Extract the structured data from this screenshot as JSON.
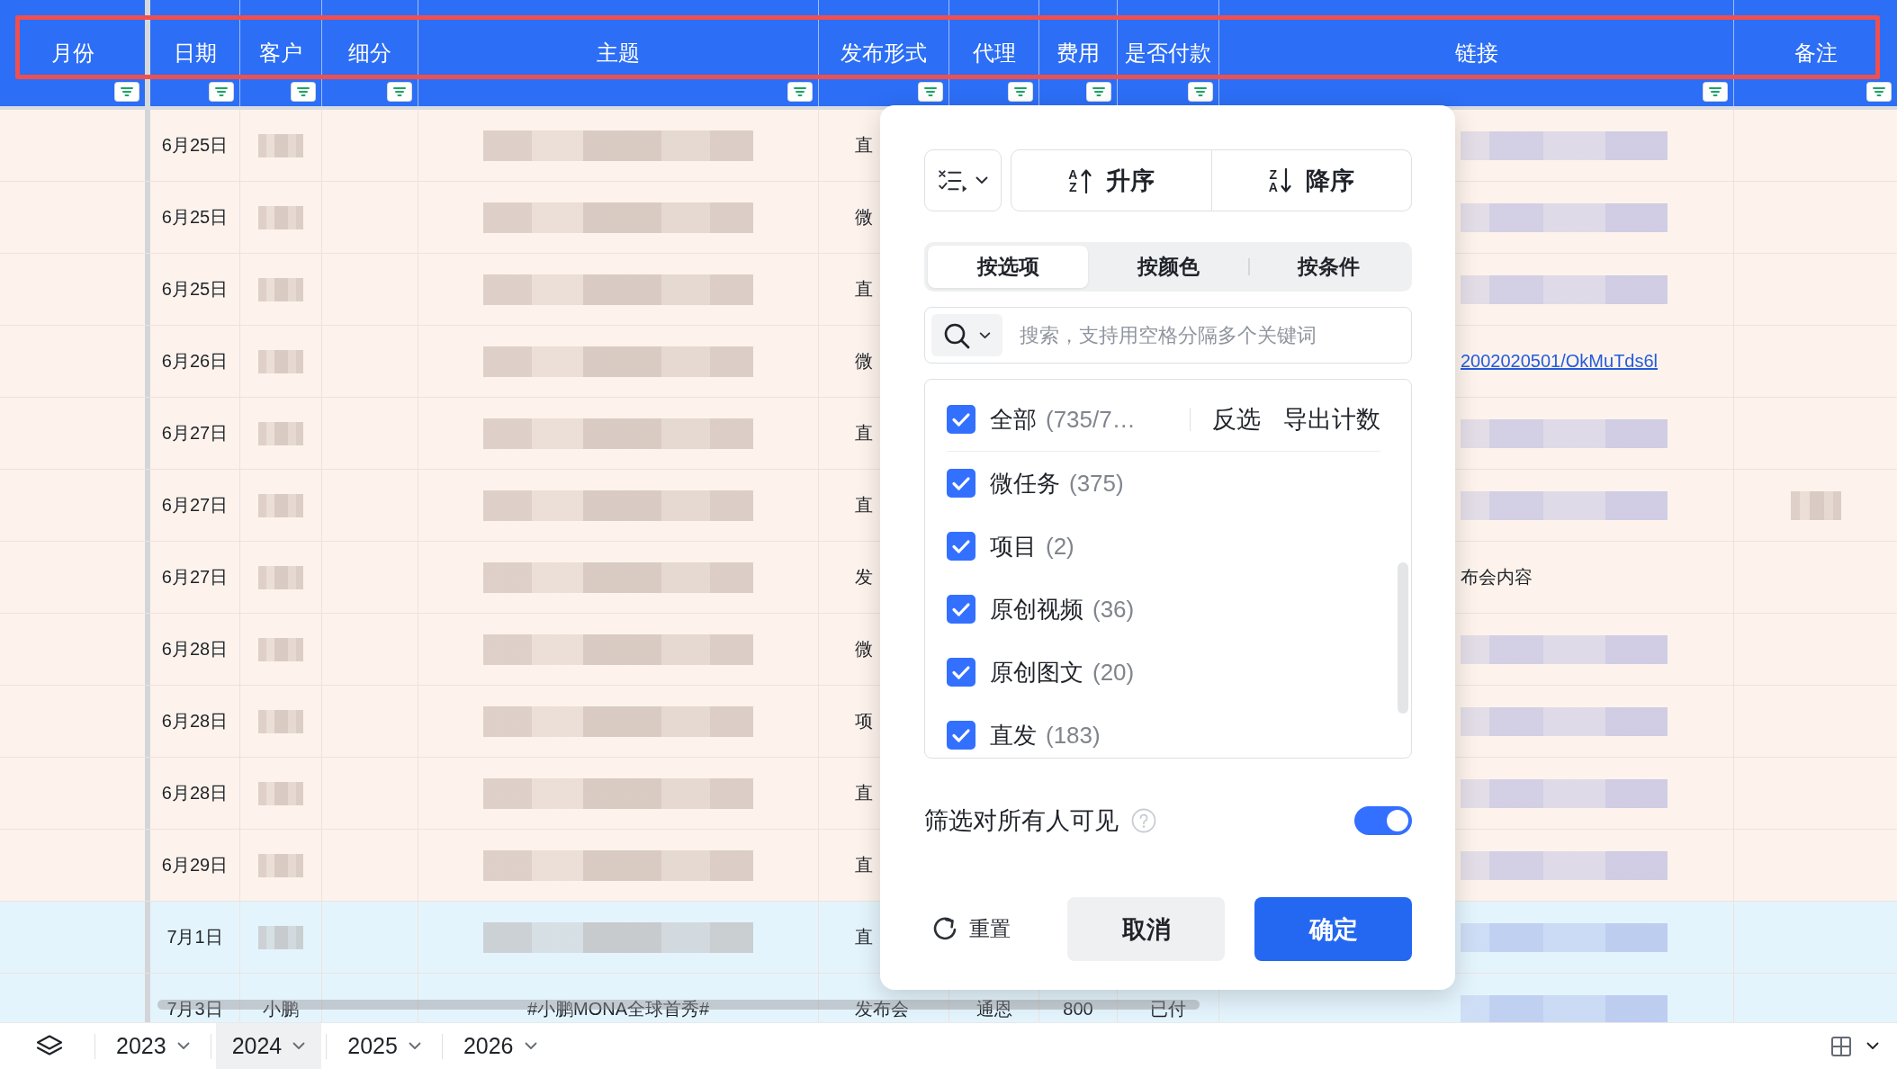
{
  "table": {
    "columns": [
      {
        "label": "月份"
      },
      {
        "label": "日期"
      },
      {
        "label": "客户"
      },
      {
        "label": "细分"
      },
      {
        "label": "主题"
      },
      {
        "label": "发布形式"
      },
      {
        "label": "代理"
      },
      {
        "label": "费用"
      },
      {
        "label": "是否付款"
      },
      {
        "label": "链接"
      },
      {
        "label": "备注"
      }
    ],
    "rows": [
      {
        "color": "#fdf3ec",
        "date": "6月25日",
        "customer": {
          "kind": "blurred"
        },
        "subject": {
          "kind": "blurred"
        },
        "format": {
          "kind": "text",
          "text": "直"
        },
        "link": {
          "kind": "blurred"
        }
      },
      {
        "color": "#fdf3ec",
        "date": "6月25日",
        "customer": {
          "kind": "blurred"
        },
        "subject": {
          "kind": "blurred"
        },
        "format": {
          "kind": "text",
          "text": "微"
        },
        "link": {
          "kind": "blurred"
        }
      },
      {
        "color": "#fdf3ec",
        "date": "6月25日",
        "customer": {
          "kind": "blurred"
        },
        "subject": {
          "kind": "blurred"
        },
        "format": {
          "kind": "text",
          "text": "直"
        },
        "link": {
          "kind": "blurred"
        }
      },
      {
        "color": "#fdf3ec",
        "date": "6月26日",
        "customer": {
          "kind": "blurred"
        },
        "subject": {
          "kind": "blurred"
        },
        "format": {
          "kind": "text",
          "text": "微"
        },
        "link": {
          "kind": "link",
          "text": "2002020501/OkMuTds6l"
        }
      },
      {
        "color": "#fdf3ec",
        "date": "6月27日",
        "customer": {
          "kind": "blurred"
        },
        "subject": {
          "kind": "blurred"
        },
        "format": {
          "kind": "text",
          "text": "直"
        },
        "link": {
          "kind": "blurred"
        }
      },
      {
        "color": "#fdf3ec",
        "date": "6月27日",
        "customer": {
          "kind": "blurred"
        },
        "subject": {
          "kind": "blurred"
        },
        "format": {
          "kind": "text",
          "text": "直"
        },
        "link": {
          "kind": "blurred"
        },
        "note": {
          "kind": "blurred"
        }
      },
      {
        "color": "#fdf3ec",
        "date": "6月27日",
        "customer": {
          "kind": "blurred"
        },
        "subject": {
          "kind": "blurred"
        },
        "format": {
          "kind": "text",
          "text": "发"
        },
        "link": {
          "kind": "text",
          "text": "布会内容"
        }
      },
      {
        "color": "#fdf3ec",
        "date": "6月28日",
        "customer": {
          "kind": "blurred"
        },
        "subject": {
          "kind": "blurred"
        },
        "format": {
          "kind": "text",
          "text": "微"
        },
        "link": {
          "kind": "blurred"
        }
      },
      {
        "color": "#fdf3ec",
        "date": "6月28日",
        "customer": {
          "kind": "blurred"
        },
        "subject": {
          "kind": "blurred"
        },
        "format": {
          "kind": "text",
          "text": "项"
        },
        "link": {
          "kind": "blurred"
        }
      },
      {
        "color": "#fdf3ec",
        "date": "6月28日",
        "customer": {
          "kind": "blurred"
        },
        "subject": {
          "kind": "blurred"
        },
        "format": {
          "kind": "text",
          "text": "直"
        },
        "link": {
          "kind": "blurred"
        }
      },
      {
        "color": "#fdf3ec",
        "date": "6月29日",
        "customer": {
          "kind": "blurred"
        },
        "subject": {
          "kind": "blurred"
        },
        "format": {
          "kind": "text",
          "text": "直"
        },
        "link": {
          "kind": "blurred"
        }
      },
      {
        "color": "#e4f4fc",
        "date": "7月1日",
        "customer": {
          "kind": "blurred"
        },
        "subject": {
          "kind": "blurred"
        },
        "format": {
          "kind": "text",
          "text": "直"
        },
        "link": {
          "kind": "blurred"
        }
      },
      {
        "color": "#e4f4fc",
        "date": "7月3日",
        "customer": {
          "kind": "text",
          "text": "小鹏"
        },
        "subject": {
          "kind": "text",
          "text": "#小鹏MONA全球首秀#"
        },
        "format": {
          "kind": "text",
          "text": "发布会"
        },
        "agent": {
          "kind": "text",
          "text": "通恩"
        },
        "fee": {
          "kind": "text",
          "text": "800"
        },
        "paid": {
          "kind": "text",
          "text": "已付"
        },
        "link": {
          "kind": "blurred"
        }
      }
    ]
  },
  "filter_popup": {
    "sort_buttons": [
      {
        "kind": "ascending",
        "icon_letters": "AZ",
        "label": "升序"
      },
      {
        "kind": "descending",
        "icon_letters": "ZA",
        "label": "降序"
      }
    ],
    "tabs": [
      {
        "label": "按选项",
        "selected": true
      },
      {
        "label": "按颜色",
        "selected": false
      },
      {
        "label": "按条件",
        "selected": false
      }
    ],
    "search": {
      "placeholder": "搜索，支持用空格分隔多个关键词"
    },
    "select_all": {
      "label": "全部",
      "count": "(735/7…",
      "checked": true
    },
    "actions": [
      {
        "label": "反选"
      },
      {
        "label": "导出计数"
      }
    ],
    "options": [
      {
        "label": "微任务",
        "count": "(375)",
        "checked": true
      },
      {
        "label": "项目",
        "count": "(2)",
        "checked": true
      },
      {
        "label": "原创视频",
        "count": "(36)",
        "checked": true
      },
      {
        "label": "原创图文",
        "count": "(20)",
        "checked": true
      },
      {
        "label": "直发",
        "count": "(183)",
        "checked": true
      }
    ],
    "visibility": {
      "label": "筛选对所有人可见",
      "on": true
    },
    "buttons": [
      {
        "kind": "reset",
        "label": "重置"
      },
      {
        "kind": "cancel",
        "label": "取消"
      },
      {
        "kind": "confirm",
        "label": "确定"
      }
    ]
  },
  "year_tabs": [
    {
      "label": "2023",
      "selected": false
    },
    {
      "label": "2024",
      "selected": true
    },
    {
      "label": "2025",
      "selected": false
    },
    {
      "label": "2026",
      "selected": false
    }
  ]
}
